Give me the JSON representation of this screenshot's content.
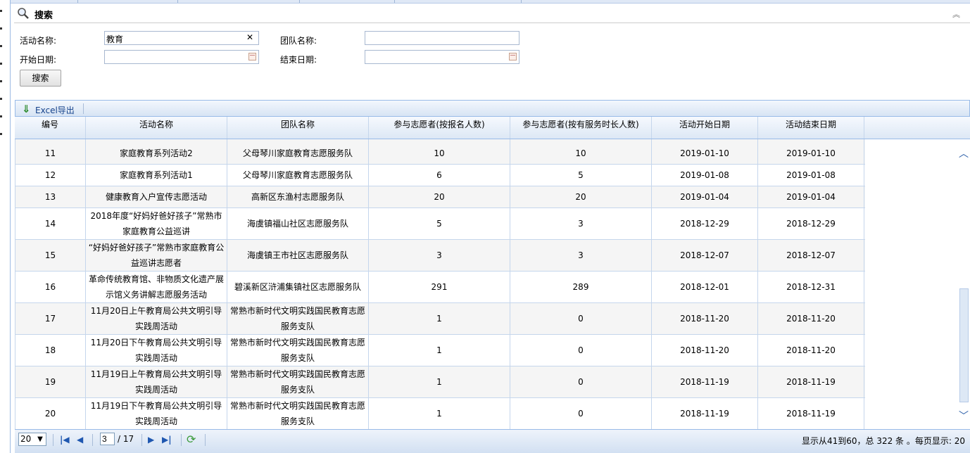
{
  "search": {
    "title": "搜索",
    "labels": {
      "activity_name": "活动名称:",
      "team_name": "团队名称:",
      "start_date": "开始日期:",
      "end_date": "结束日期:"
    },
    "values": {
      "activity_name": "教育",
      "team_name": "",
      "start_date": "",
      "end_date": ""
    },
    "clear_glyph": "✕",
    "button_label": "搜索",
    "collapse_glyph": "︽"
  },
  "toolbar": {
    "excel_label": "Excel导出"
  },
  "grid": {
    "columns": [
      "编号",
      "活动名称",
      "团队名称",
      "参与志愿者(按报名人数)",
      "参与志愿者(按有服务时长人数)",
      "活动开始日期",
      "活动结束日期"
    ],
    "rows": [
      {
        "id": "11",
        "name": "家庭教育系列活动2",
        "team": "父母琴川家庭教育志愿服务队",
        "signup": "10",
        "served": "10",
        "start": "2019-01-10",
        "end": "2019-01-10"
      },
      {
        "id": "12",
        "name": "家庭教育系列活动1",
        "team": "父母琴川家庭教育志愿服务队",
        "signup": "6",
        "served": "5",
        "start": "2019-01-08",
        "end": "2019-01-08"
      },
      {
        "id": "13",
        "name": "健康教育入户宣传志愿活动",
        "team": "高新区东渔村志愿服务队",
        "signup": "20",
        "served": "20",
        "start": "2019-01-04",
        "end": "2019-01-04"
      },
      {
        "id": "14",
        "name": "2018年度“好妈好爸好孩子”常熟市家庭教育公益巡讲",
        "team": "海虞镇福山社区志愿服务队",
        "signup": "5",
        "served": "3",
        "start": "2018-12-29",
        "end": "2018-12-29"
      },
      {
        "id": "15",
        "name": "“好妈好爸好孩子”常熟市家庭教育公益巡讲志愿者",
        "team": "海虞镇王市社区志愿服务队",
        "signup": "3",
        "served": "3",
        "start": "2018-12-07",
        "end": "2018-12-07"
      },
      {
        "id": "16",
        "name": "革命传统教育馆、非物质文化遗产展示馆义务讲解志愿服务活动",
        "team": "碧溪新区浒浦集镇社区志愿服务队",
        "signup": "291",
        "served": "289",
        "start": "2018-12-01",
        "end": "2018-12-31"
      },
      {
        "id": "17",
        "name": "11月20日上午教育局公共文明引导实践周活动",
        "team": "常熟市新时代文明实践国民教育志愿服务支队",
        "signup": "1",
        "served": "0",
        "start": "2018-11-20",
        "end": "2018-11-20"
      },
      {
        "id": "18",
        "name": "11月20日下午教育局公共文明引导实践周活动",
        "team": "常熟市新时代文明实践国民教育志愿服务支队",
        "signup": "1",
        "served": "0",
        "start": "2018-11-20",
        "end": "2018-11-20"
      },
      {
        "id": "19",
        "name": "11月19日上午教育局公共文明引导实践周活动",
        "team": "常熟市新时代文明实践国民教育志愿服务支队",
        "signup": "1",
        "served": "0",
        "start": "2018-11-19",
        "end": "2018-11-19"
      },
      {
        "id": "20",
        "name": "11月19日下午教育局公共文明引导实践周活动",
        "team": "常熟市新时代文明实践国民教育志愿服务支队",
        "signup": "1",
        "served": "0",
        "start": "2018-11-19",
        "end": "2018-11-19"
      }
    ]
  },
  "pager": {
    "page_size": "20",
    "current_page": "3",
    "total_pages": "/ 17",
    "info": "显示从41到60，总 322 条 。每页显示: 20"
  }
}
